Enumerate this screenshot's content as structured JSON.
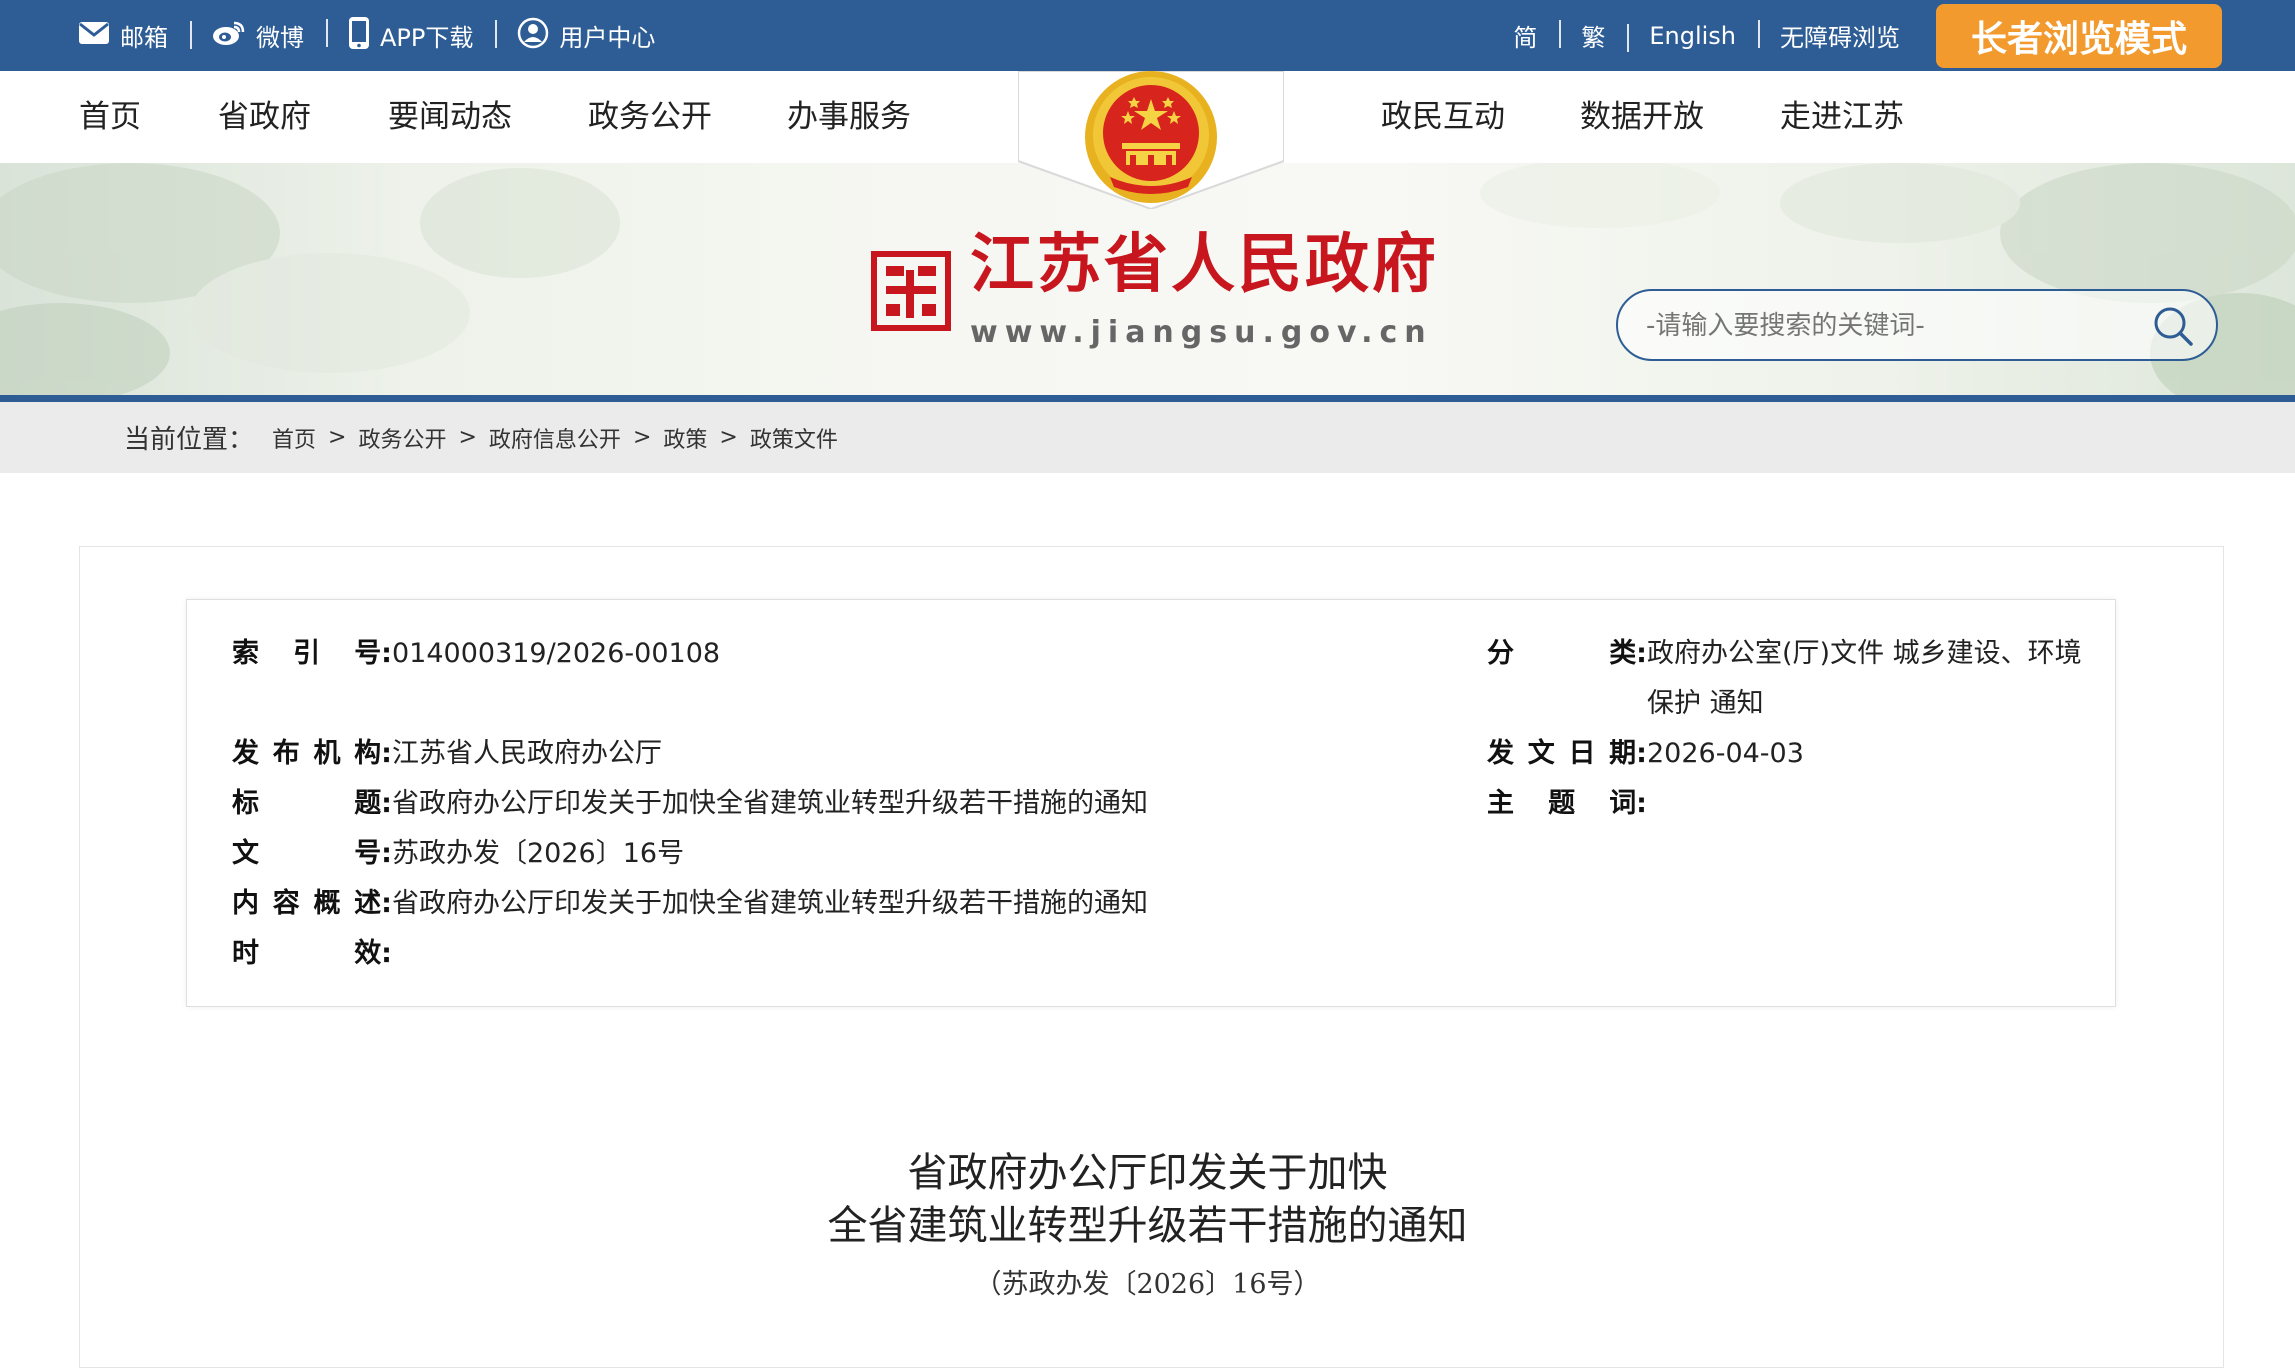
{
  "topbar": {
    "left_links": [
      {
        "label": "邮箱",
        "icon": "mail-icon"
      },
      {
        "label": "微博",
        "icon": "weibo-icon"
      },
      {
        "label": "APP下载",
        "icon": "phone-icon"
      },
      {
        "label": "用户中心",
        "icon": "user-icon"
      }
    ],
    "right_links": [
      "简",
      "繁",
      "English",
      "无障碍浏览"
    ],
    "elder_mode": "长者浏览模式"
  },
  "nav": {
    "left": [
      "首页",
      "省政府",
      "要闻动态",
      "政务公开",
      "办事服务"
    ],
    "right": [
      "政民互动",
      "数据开放",
      "走进江苏"
    ]
  },
  "banner": {
    "site_name": "江苏省人民政府",
    "site_url": "www.jiangsu.gov.cn",
    "search_placeholder": "-请输入要搜索的关键词-"
  },
  "breadcrumb": {
    "label": "当前位置：",
    "items": [
      "首页",
      "政务公开",
      "政府信息公开",
      "政策",
      "政策文件"
    ],
    "separator": ">"
  },
  "meta": {
    "index_no": {
      "label": [
        "索",
        "引",
        "号:"
      ],
      "value": "014000319/2026-00108"
    },
    "category": {
      "label": [
        "分",
        "类:"
      ],
      "value_line1": "政府办公室(厅)文件 城乡建设、环境",
      "value_line2": "保护 通知"
    },
    "publisher": {
      "label": [
        "发",
        "布",
        "机",
        "构:"
      ],
      "value": "江苏省人民政府办公厅"
    },
    "date": {
      "label": [
        "发",
        "文",
        "日",
        "期:"
      ],
      "value": "2026-04-03"
    },
    "title": {
      "label": [
        "标",
        "题:"
      ],
      "value": "省政府办公厅印发关于加快全省建筑业转型升级若干措施的通知"
    },
    "subject": {
      "label": [
        "主",
        "题",
        "词:"
      ],
      "value": ""
    },
    "doc_no": {
      "label": [
        "文",
        "号:"
      ],
      "value": "苏政办发〔2026〕16号"
    },
    "summary": {
      "label": [
        "内",
        "容",
        "概",
        "述:"
      ],
      "value": "省政府办公厅印发关于加快全省建筑业转型升级若干措施的通知"
    },
    "validity": {
      "label": [
        "时",
        "效:"
      ],
      "value": ""
    }
  },
  "document": {
    "title_line1": "省政府办公厅印发关于加快",
    "title_line2": "全省建筑业转型升级若干措施的通知",
    "doc_number": "（苏政办发〔2026〕16号）"
  },
  "colors": {
    "primary": "#2e5d95",
    "brand_red": "#c7161e",
    "accent_orange": "#f29a2e"
  }
}
